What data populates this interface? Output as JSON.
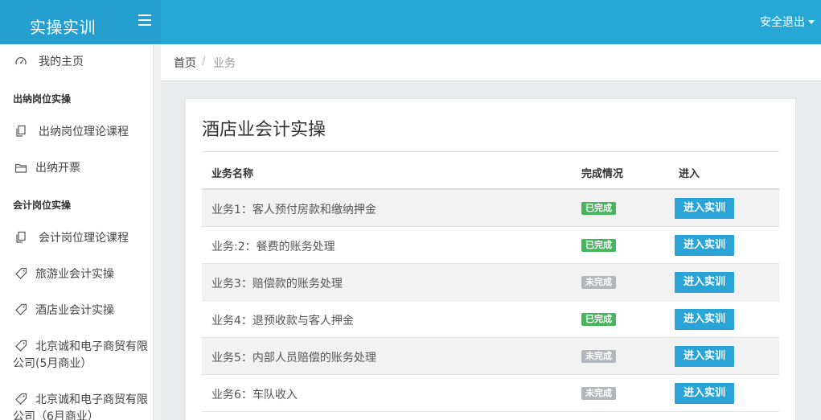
{
  "header": {
    "brand": "实操实训",
    "logout": "安全退出"
  },
  "sidebar": {
    "items": [
      {
        "label": "我的主页",
        "icon": "dashboard-icon"
      },
      {
        "section": "出纳岗位实操"
      },
      {
        "label": "出纳岗位理论课程",
        "icon": "copy-icon"
      },
      {
        "label": "出纳开票",
        "icon": "folder-icon"
      },
      {
        "section": "会计岗位实操"
      },
      {
        "label": "会计岗位理论课程",
        "icon": "copy-icon"
      },
      {
        "label": "旅游业会计实操",
        "icon": "tag-icon"
      },
      {
        "label": "酒店业会计实操",
        "icon": "tag-icon"
      },
      {
        "label": "北京诚和电子商贸有限公司(5月商业）",
        "line1": "北京诚和电子商贸有限",
        "line2": "公司(5月商业）",
        "icon": "tag-icon"
      },
      {
        "label": "北京诚和电子商贸有限公司（6月商业）",
        "line1": "北京诚和电子商贸有限",
        "line2": "公司（6月商业）",
        "icon": "tag-icon"
      }
    ]
  },
  "breadcrumb": {
    "home": "首页",
    "separator": "/",
    "current": "业务"
  },
  "main": {
    "title": "酒店业会计实操",
    "columns": [
      "业务名称",
      "完成情况",
      "进入"
    ],
    "rows": [
      {
        "name": "业务1：客人预付房款和缴纳押金",
        "status": "已完成",
        "done": true,
        "action": "进入实训"
      },
      {
        "name": "业务:2：餐费的账务处理",
        "status": "已完成",
        "done": true,
        "action": "进入实训"
      },
      {
        "name": "业务3：赔偿款的账务处理",
        "status": "未完成",
        "done": false,
        "action": "进入实训"
      },
      {
        "name": "业务4：退预收款与客人押金",
        "status": "已完成",
        "done": true,
        "action": "进入实训"
      },
      {
        "name": "业务5：内部人员赔偿的账务处理",
        "status": "未完成",
        "done": false,
        "action": "进入实训"
      },
      {
        "name": "业务6：车队收入",
        "status": "未完成",
        "done": false,
        "action": "进入实训"
      }
    ]
  },
  "colors": {
    "primary": "#27a7d6",
    "done": "#45b65d",
    "todo": "#b2b7bd"
  }
}
